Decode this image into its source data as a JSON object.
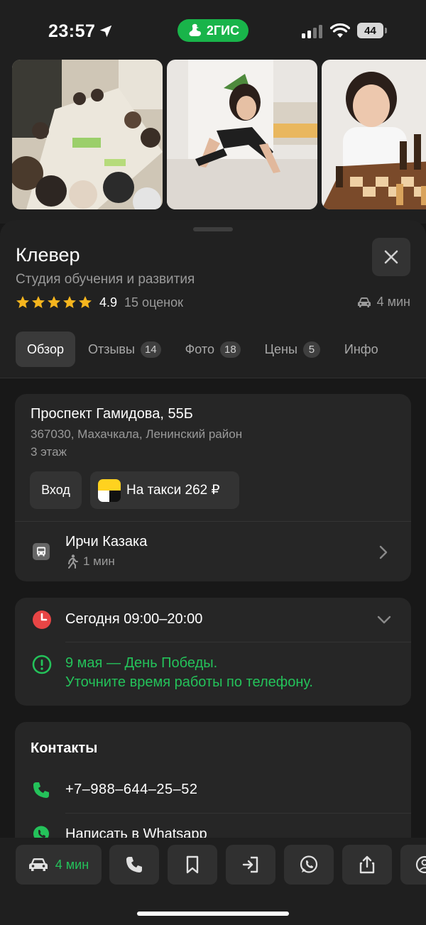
{
  "status_bar": {
    "time": "23:57",
    "brand": "2ГИС",
    "battery": "44",
    "icons": [
      "location-arrow-icon",
      "signal-icon",
      "wifi-icon",
      "battery-icon"
    ]
  },
  "photos": [
    {
      "name": "photo-classroom"
    },
    {
      "name": "photo-plank"
    },
    {
      "name": "photo-chess"
    }
  ],
  "place": {
    "name": "Клевер",
    "category": "Студия обучения и развития",
    "rating": "4.9",
    "rating_stars": 5,
    "rating_count": "15 оценок",
    "drive_time": "4 мин"
  },
  "tabs": [
    {
      "label": "Обзор",
      "badge": ""
    },
    {
      "label": "Отзывы",
      "badge": "14"
    },
    {
      "label": "Фото",
      "badge": "18"
    },
    {
      "label": "Цены",
      "badge": "5"
    },
    {
      "label": "Инфо",
      "badge": ""
    }
  ],
  "address": {
    "street": "Проспект Гамидова, 55Б",
    "city": "367030, Махачкала, Ленинский район",
    "floor": "3 этаж",
    "entry_label": "Вход",
    "taxi_label": "На такси 262 ₽",
    "stop_name": "Ирчи Казака",
    "walk_time": "1 мин"
  },
  "hours": {
    "today": "Сегодня 09:00–20:00",
    "holiday_line1": "9 мая — День Победы.",
    "holiday_line2": "Уточните время работы по телефону."
  },
  "contacts": {
    "title": "Контакты",
    "phone": "+7‒988‒644‒25‒52",
    "whatsapp": "Написать в Whatsapp"
  },
  "action_bar": {
    "route_time": "4 мин"
  },
  "colors": {
    "accent_green": "#24c25a",
    "brand_green": "#19b44a",
    "star": "#f5b51e",
    "clock_red": "#e84545"
  }
}
